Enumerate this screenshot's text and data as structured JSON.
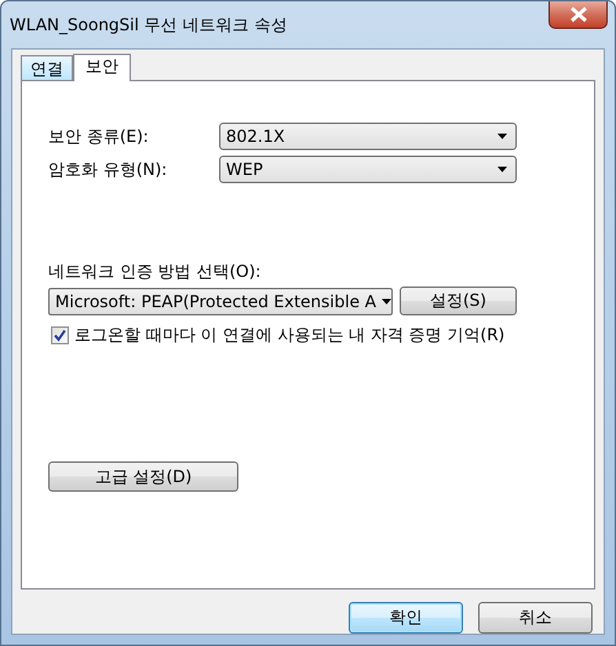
{
  "window": {
    "title": "WLAN_SoongSil 무선 네트워크 속성"
  },
  "tabs": [
    {
      "label": "연결",
      "selected": false
    },
    {
      "label": "보안",
      "selected": true
    }
  ],
  "fields": [
    {
      "label": "보안 종류(E):",
      "value": "802.1X"
    },
    {
      "label": "암호화 유형(N):",
      "value": "WEP"
    }
  ],
  "auth": {
    "label": "네트워크 인증 방법 선택(O):",
    "value": "Microsoft: PEAP(Protected Extensible A",
    "button": "설정(S)"
  },
  "remember": {
    "label": "로그온할 때마다 이 연결에 사용되는 내 자격 증명 기억(R)",
    "checked": true
  },
  "advanced_button": "고급 설정(D)",
  "buttons": [
    {
      "label": "확인",
      "kind": "default"
    },
    {
      "label": "취소",
      "kind": "normal"
    }
  ]
}
